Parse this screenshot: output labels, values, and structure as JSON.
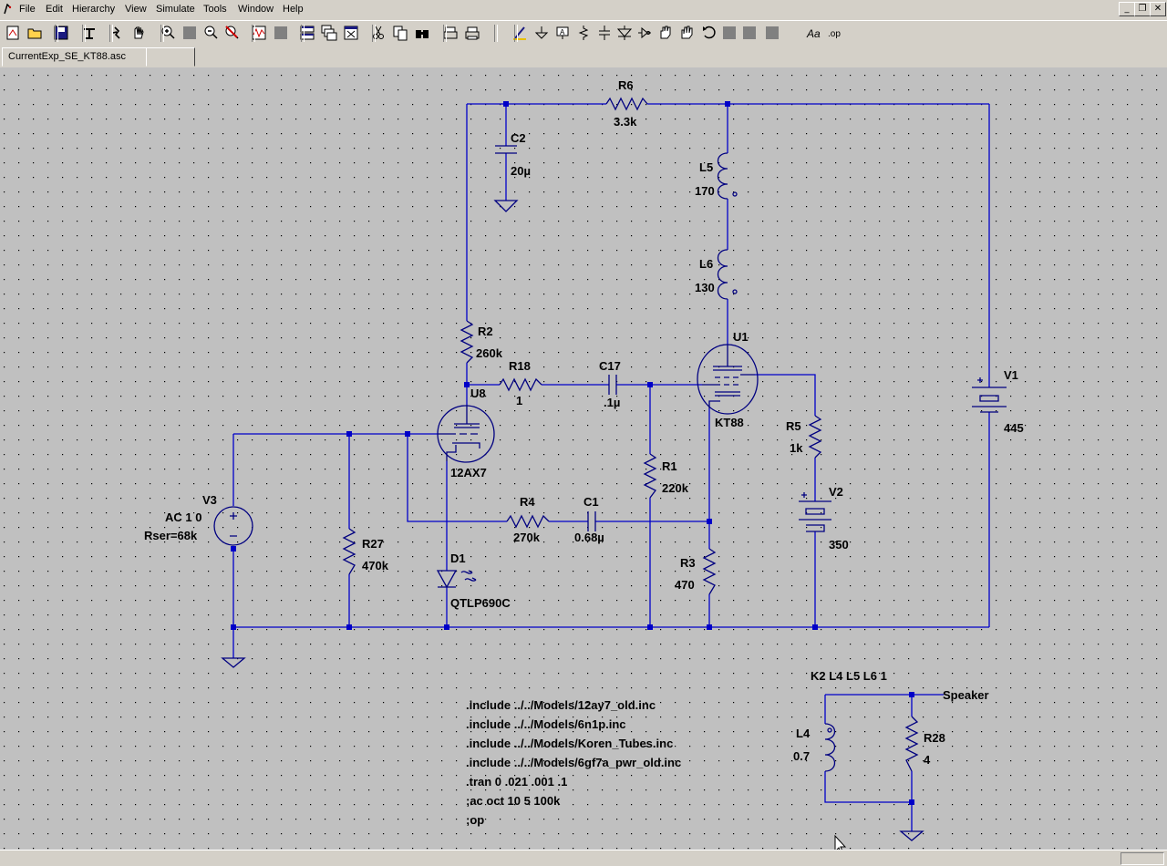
{
  "menu": [
    "File",
    "Edit",
    "Hierarchy",
    "View",
    "Simulate",
    "Tools",
    "Window",
    "Help"
  ],
  "tabs": [
    {
      "label": "CurrentExp_SE_KT88.asc"
    },
    {
      "label": ""
    }
  ],
  "window_buttons": {
    "minimize": "_",
    "restore": "❐",
    "close": "✕"
  },
  "toolbar_icons": [
    "new-schematic-icon",
    "open-icon",
    "save-icon",
    "control-panel-icon",
    "run-icon",
    "halt-icon",
    "zoom-in-icon",
    "pan-icon",
    "zoom-out-icon",
    "zoom-cancel-icon",
    "waveform-icon",
    "blank-icon",
    "tile-icon",
    "cascade-icon",
    "close-window-icon",
    "cut-icon",
    "copy-icon",
    "find-icon",
    "print-preview-icon",
    "print-icon",
    "draw-wire-icon",
    "ground-icon",
    "label-net-icon",
    "resistor-icon",
    "capacitor-icon",
    "diode-icon",
    "component-icon",
    "move-icon",
    "drag-icon",
    "undo-icon",
    "redo-icon",
    "rotate-icon",
    "mirror-icon",
    "blank-icon-2",
    "text-icon",
    "spice-directive-icon"
  ],
  "components": {
    "R6": {
      "name": "R6",
      "value": "3.3k"
    },
    "C2": {
      "name": "C2",
      "value": "20µ"
    },
    "L5": {
      "name": "L5",
      "value": "170"
    },
    "L6": {
      "name": "L6",
      "value": "130"
    },
    "U1": {
      "name": "U1",
      "value": "KT88"
    },
    "V1": {
      "name": "V1",
      "value": "445"
    },
    "R2": {
      "name": "R2",
      "value": "260k"
    },
    "R18": {
      "name": "R18",
      "value": "1"
    },
    "C17": {
      "name": "C17",
      "value": ".1µ"
    },
    "U8": {
      "name": "U8",
      "value": "12AX7"
    },
    "R5": {
      "name": "R5",
      "value": "1k"
    },
    "R1": {
      "name": "R1",
      "value": "220k"
    },
    "V2": {
      "name": "V2",
      "value": "350"
    },
    "V3": {
      "name": "V3",
      "value": "AC 1 0",
      "value2": "Rser=68k"
    },
    "R4": {
      "name": "R4",
      "value": "270k"
    },
    "C1": {
      "name": "C1",
      "value": "0.68µ"
    },
    "R27": {
      "name": "R27",
      "value": "470k"
    },
    "R3": {
      "name": "R3",
      "value": "470"
    },
    "D1": {
      "name": "D1",
      "value": "QTLP690C"
    },
    "L4": {
      "name": "L4",
      "value": "0.7"
    },
    "R28": {
      "name": "R28",
      "value": "4"
    }
  },
  "coupling_directive": "K2 L4 L5 L6 1",
  "net_label": "Speaker",
  "spice_directives": [
    ".include ../../Models/12ay7_old.inc",
    ".include ../../Models/6n1p.inc",
    ".include ../../Models/Koren_Tubes.inc",
    ".include ../../Models/6gf7a_pwr_old.inc",
    ".tran 0 .021 .001 .1",
    ";ac oct 10 5 100k",
    ";op"
  ],
  "colors": {
    "wire": "#0000c8",
    "component": "#000080",
    "grid_dot": "#000000",
    "canvas": "#c0c0c0",
    "chrome": "#d4d0c8"
  }
}
